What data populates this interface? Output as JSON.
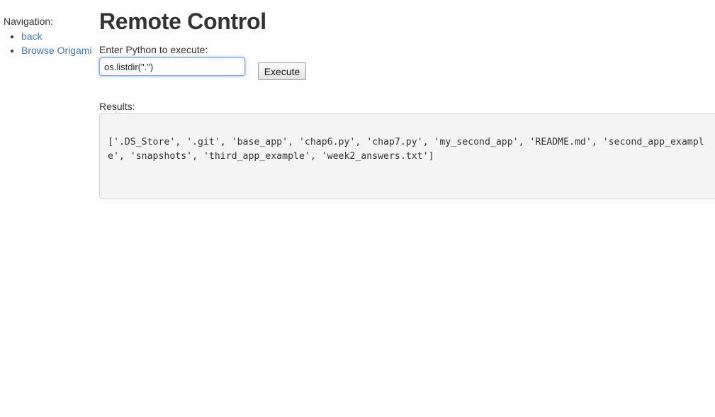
{
  "navigation": {
    "heading": "Navigation:",
    "items": [
      {
        "label": "back"
      },
      {
        "label": "Browse Origami"
      }
    ]
  },
  "main": {
    "title": "Remote Control",
    "prompt_label": "Enter Python to execute:",
    "input_value": "os.listdir(\".\")",
    "execute_label": "Execute",
    "results_label": "Results:",
    "results_text": "['.DS_Store', '.git', 'base_app', 'chap6.py', 'chap7.py', 'my_second_app', 'README.md', 'second_app_example', 'snapshots', 'third_app_example', 'week2_answers.txt']"
  },
  "colors": {
    "link": "#3b7dc8",
    "text": "#333333",
    "results_background": "#f4f4f4",
    "input_focus": "#7aa7e0"
  }
}
